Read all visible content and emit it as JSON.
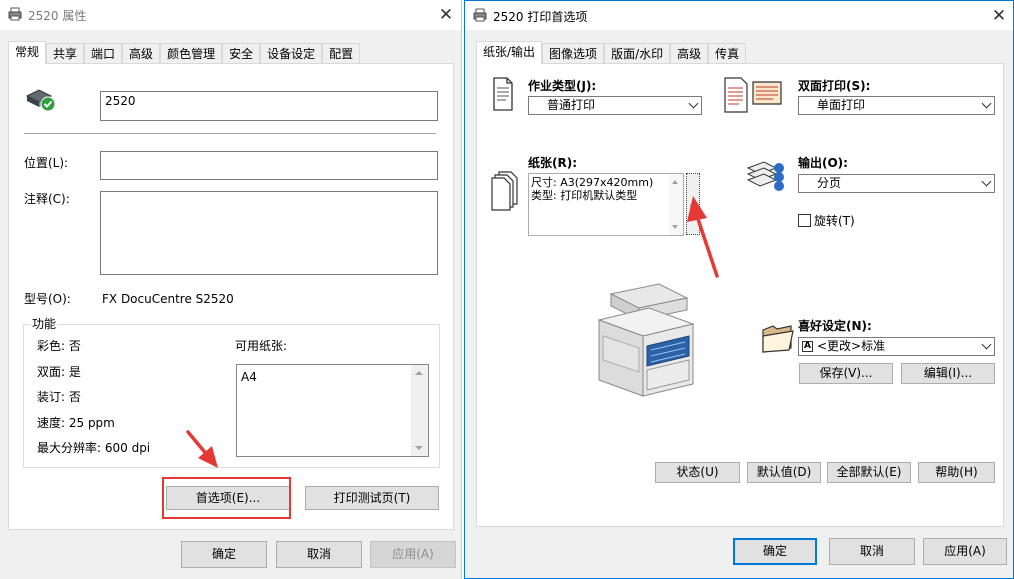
{
  "left_window": {
    "title": "2520 属性",
    "close_glyph": "✕",
    "tabs": [
      "常规",
      "共享",
      "端口",
      "高级",
      "颜色管理",
      "安全",
      "设备设定",
      "配置"
    ],
    "active_tab": 0,
    "printer_name_value": "2520",
    "location_label": "位置(L):",
    "location_value": "",
    "comment_label": "注释(C):",
    "comment_value": "",
    "model_label": "型号(O):",
    "model_value": "FX DocuCentre S2520",
    "features": {
      "title": "功能",
      "color": "彩色: 否",
      "duplex": "双面: 是",
      "staple": "装订: 否",
      "speed": "速度: 25 ppm",
      "max_resolution": "最大分辨率: 600 dpi",
      "available_paper_label": "可用纸张:",
      "paper_list": [
        "A4"
      ]
    },
    "preferences_button": "首选项(E)...",
    "print_test_button": "打印测试页(T)",
    "ok_button": "确定",
    "cancel_button": "取消",
    "apply_button": "应用(A)"
  },
  "right_window": {
    "title": "2520 打印首选项",
    "close_glyph": "✕",
    "tabs": [
      "纸张/输出",
      "图像选项",
      "版面/水印",
      "高级",
      "传真"
    ],
    "active_tab": 0,
    "job_type_label": "作业类型(J):",
    "job_type_value": "普通打印",
    "duplex_label": "双面打印(S):",
    "duplex_value": "单面打印",
    "paper_label": "纸张(R):",
    "paper_size_line": "尺寸: A3(297x420mm)",
    "paper_type_line": "类型: 打印机默认类型",
    "paper_expand_glyph": "⌄",
    "output_label": "输出(O):",
    "output_value": "分页",
    "rotate_label": "旋转(T)",
    "rotate_checked": false,
    "favorites_label": "喜好设定(N):",
    "favorites_value": "<更改>标准",
    "favorites_icon_letter": "A",
    "save_button": "保存(V)...",
    "edit_button": "编辑(I)...",
    "status_button": "状态(U)",
    "defaults_button": "默认值(D)",
    "all_defaults_button": "全部默认(E)",
    "help_button": "帮助(H)",
    "ok_button": "确定",
    "cancel_button": "取消",
    "apply_button": "应用(A)"
  },
  "colors": {
    "accent": "#0078d7",
    "annotation_red": "#e53935",
    "window_bg": "#f0f0f0"
  }
}
